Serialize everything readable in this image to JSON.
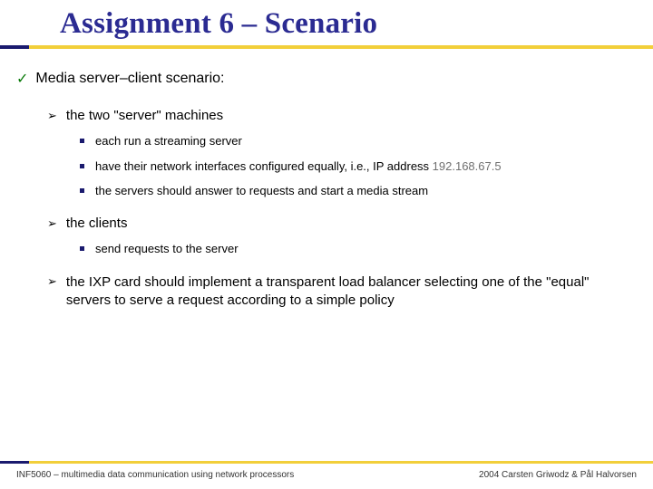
{
  "title": "Assignment 6 – Scenario",
  "l1": {
    "mark": "✓",
    "text": "Media server–client scenario:"
  },
  "servers": {
    "mark": "➢",
    "heading": "the two \"server\" machines",
    "items": [
      "each run a streaming server",
      "have their network interfaces configured equally, i.e., IP address ",
      "the servers should answer to requests and start a media stream"
    ],
    "ip": "192.168.67.5"
  },
  "clients": {
    "mark": "➢",
    "heading": "the clients",
    "items": [
      "send requests to the server"
    ]
  },
  "ixp": {
    "mark": "➢",
    "text": "the IXP card should implement a transparent load balancer selecting one of the \"equal\" servers to serve a request according to a simple policy"
  },
  "footer": {
    "left": "INF5060 – multimedia data communication using network processors",
    "right": "2004 Carsten Griwodz & Pål Halvorsen"
  }
}
